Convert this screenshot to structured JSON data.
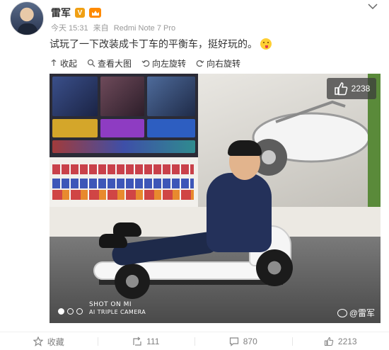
{
  "post": {
    "username": "雷军",
    "v_badge": "V",
    "time": "今天 15:31",
    "source_prefix": "来自",
    "source": "Redmi Note 7 Pro",
    "text": "试玩了一下改装成卡丁车的平衡车，挺好玩的。"
  },
  "toolbar": {
    "collapse": "收起",
    "view_large": "查看大图",
    "rotate_left": "向左旋转",
    "rotate_right": "向右旋转"
  },
  "photo": {
    "like_count": "2238",
    "shot_line1": "SHOT ON MI",
    "shot_line2": "AI TRIPLE CAMERA",
    "watermark": "@雷军",
    "page_dots": 3,
    "active_dot": 0
  },
  "footer": {
    "favorite": "收藏",
    "repost_count": "111",
    "comment_count": "870",
    "like_count": "2213"
  },
  "colors": {
    "accent_orange": "#f0a014",
    "text": "#333333",
    "muted": "#999999"
  },
  "icons": [
    "chevron-down-icon",
    "collapse-icon",
    "zoom-icon",
    "rotate-left-icon",
    "rotate-right-icon",
    "thumb-up-icon",
    "star-icon",
    "repost-icon",
    "comment-icon",
    "weibo-logo-icon"
  ]
}
